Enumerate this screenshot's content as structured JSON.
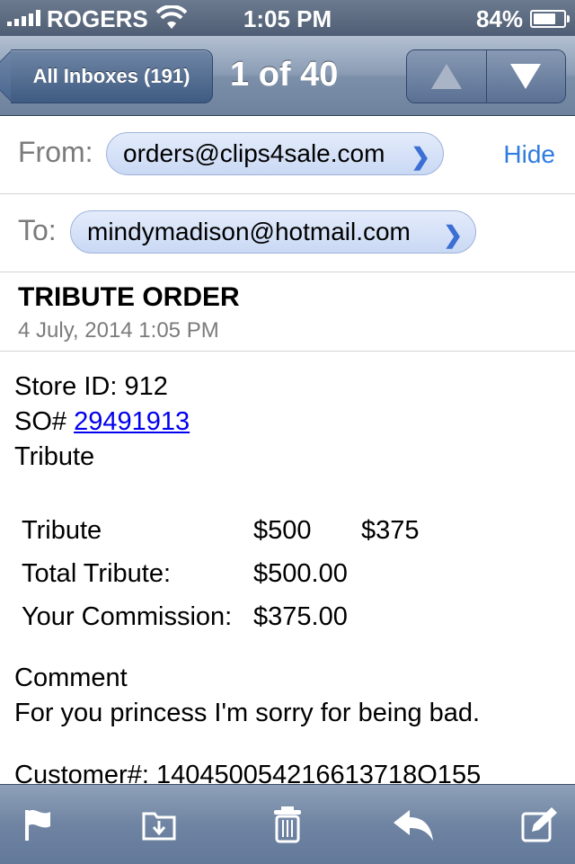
{
  "status_bar": {
    "carrier": "ROGERS",
    "time": "1:05 PM",
    "battery_percent": "84%",
    "battery_level": 0.84
  },
  "nav": {
    "back_label": "All Inboxes (191)",
    "title": "1 of 40",
    "up_icon": "arrow-up-icon",
    "down_icon": "arrow-down-icon"
  },
  "header": {
    "from_label": "From:",
    "from_address": "orders@clips4sale.com",
    "hide_label": "Hide",
    "to_label": "To:",
    "to_address": "mindymadison@hotmail.com",
    "subject": "TRIBUTE ORDER",
    "date": "4 July, 2014 1:05 PM"
  },
  "body": {
    "store_id": "Store ID: 912",
    "so_prefix": "SO# ",
    "so_number": "29491913",
    "type_line": "Tribute",
    "table": [
      [
        "Tribute",
        "$500",
        "$375"
      ],
      [
        "Total Tribute:",
        "$500.00",
        ""
      ],
      [
        "Your Commission:",
        "$375.00",
        ""
      ]
    ],
    "comment_label": "Comment",
    "comment_text": "For you princess I'm sorry for being bad.",
    "customer_line": "Customer#: 140450054216613718O155"
  },
  "toolbar": {
    "icons": [
      "flag-icon",
      "move-to-folder-icon",
      "trash-icon",
      "reply-icon",
      "compose-icon"
    ]
  },
  "colors": {
    "link": "#0000ee",
    "hide_link": "#2f7ce0",
    "nav_bar": "#7c8fa9"
  }
}
